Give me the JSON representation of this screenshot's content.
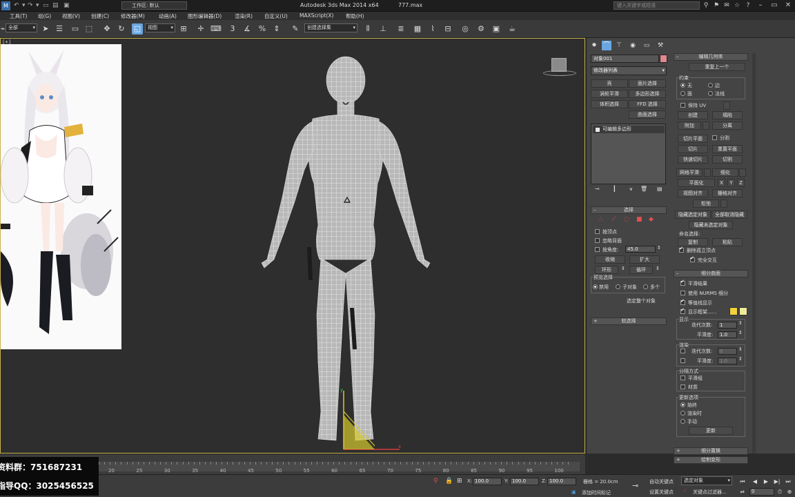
{
  "titlebar": {
    "workspace": "工作区: 默认",
    "app_title": "Autodesk 3ds Max  2014 x64",
    "file_title": "777.max",
    "search_placeholder": "键入关键字或短语"
  },
  "menu": [
    "工具(T)",
    "组(G)",
    "视图(V)",
    "创建(C)",
    "修改器(M)",
    "动画(A)",
    "图形编辑器(D)",
    "渲染(R)",
    "自定义(U)",
    "MAXScript(X)",
    "帮助(H)"
  ],
  "toolbar": {
    "selection_filter": "全部",
    "ref_coord": "视图",
    "named_selection": "创建选择集"
  },
  "viewport": {
    "label": "[+]"
  },
  "command_panel": {
    "object_name": "对象001",
    "modifier_list": "修改器列表",
    "mod_buttons": [
      "壳",
      "面片选择",
      "涡轮平滑",
      "多边形选择",
      "体积选择",
      "FFD 选择",
      "曲面选择"
    ],
    "stack_item": "可编辑多边形",
    "selection_title": "选择",
    "by_vertex": "按顶点",
    "ignore_backface": "忽略背面",
    "by_angle": "按角度:",
    "angle_value": "45.0",
    "shrink": "收缩",
    "grow": "扩大",
    "ring": "环形",
    "loop": "循环",
    "preview_title": "预览选择",
    "preview_opts": [
      "禁用",
      "子对象",
      "多个"
    ],
    "select_whole": "选定整个对象",
    "soft_select": "软选择"
  },
  "edit_geometry": {
    "title": "编辑几何体",
    "repeat_last": "重复上一个",
    "constraints": "约束",
    "c_none": "无",
    "c_edge": "边",
    "c_face": "面",
    "c_normal": "法线",
    "preserve_uv": "保持 UV",
    "create": "创建",
    "collapse": "塌陷",
    "attach": "附加",
    "detach": "分离",
    "slice_plane": "切片平面",
    "split": "分割",
    "slice": "切片",
    "reset_plane": "重置平面",
    "quick_slice": "快速切片",
    "cut": "切割",
    "meshsmooth": "网格平滑",
    "tessellate": "细化",
    "make_planar": "平面化",
    "x": "X",
    "y": "Y",
    "z": "Z",
    "view_align": "视图对齐",
    "grid_align": "栅格对齐",
    "relax": "松弛",
    "hide_selected": "隐藏选定对象",
    "unhide_all": "全部取消隐藏",
    "hide_unselected": "隐藏未选定对象",
    "named_sel": "命名选择:",
    "copy": "复制",
    "paste": "粘贴",
    "delete_isolated": "删除孤立顶点",
    "full_interactivity": "完全交互"
  },
  "subdivision": {
    "title": "细分曲面",
    "smooth_result": "平滑结果",
    "use_nurms": "使用 NURMS 细分",
    "isoline": "等值线显示",
    "show_cage": "显示框架......",
    "display": "显示",
    "iterations": "迭代次数:",
    "iter_val": "1",
    "smoothness": "平滑度:",
    "smooth_val": "1.0",
    "render": "渲染",
    "r_iter_val": "0",
    "r_smooth_val": "1.0",
    "separate_by": "分隔方式",
    "smoothing_groups": "平滑组",
    "materials": "材质",
    "update_opts": "更新选项",
    "always": "始终",
    "when_rendering": "渲染时",
    "manually": "手动",
    "update": "更新",
    "displacement": "细分置换",
    "paint_deform": "绘制变形",
    "cage_color_1": "#f2d13b",
    "cage_color_2": "#eeeb9a"
  },
  "timeline": {
    "ticks": [
      "20",
      "25",
      "30",
      "35",
      "40",
      "45",
      "50",
      "55",
      "60",
      "65",
      "70",
      "75",
      "80",
      "85",
      "90",
      "95",
      "100"
    ]
  },
  "status": {
    "x_val": "100.0",
    "y_val": "100.0",
    "z_val": "100.0",
    "grid": "栅格 = 20.0cm",
    "add_time_tag": "添加时间标记",
    "auto_key": "自动关键点",
    "set_key": "设置关键点",
    "selected_obj": "选定对象",
    "key_filters": "关键点过滤器...",
    "frame": "0"
  },
  "overlay": {
    "line1": "资料群：751687231",
    "line2": "指导QQ：3025456525"
  }
}
